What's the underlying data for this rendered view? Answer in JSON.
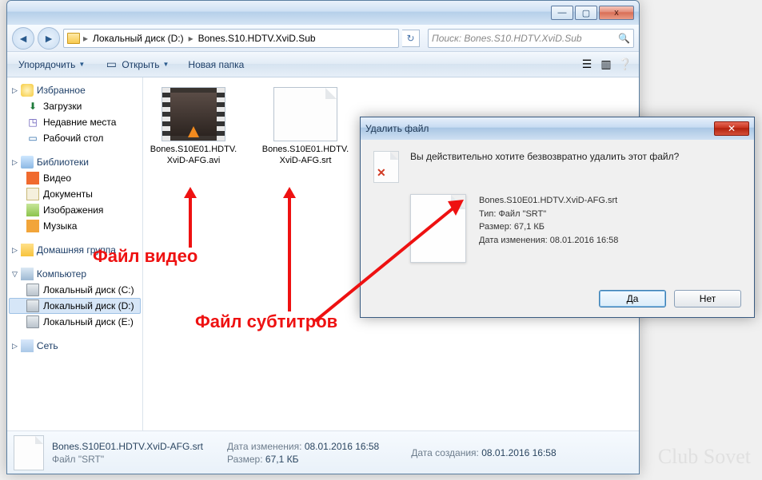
{
  "window": {
    "min": "—",
    "max": "▢",
    "close": "x"
  },
  "nav": {
    "back": "◄",
    "fwd": "►",
    "crumb_drive": "Локальный диск (D:)",
    "crumb_folder": "Bones.S10.HDTV.XviD.Sub",
    "sep": "▸",
    "search_placeholder": "Поиск: Bones.S10.HDTV.XviD.Sub"
  },
  "toolbar": {
    "organize": "Упорядочить",
    "open": "Открыть",
    "newfolder": "Новая папка"
  },
  "sidebar": {
    "fav": "Избранное",
    "fav_items": [
      "Загрузки",
      "Недавние места",
      "Рабочий стол"
    ],
    "lib": "Библиотеки",
    "lib_items": [
      "Видео",
      "Документы",
      "Изображения",
      "Музыка"
    ],
    "home": "Домашняя группа",
    "comp": "Компьютер",
    "drives": [
      "Локальный диск (C:)",
      "Локальный диск (D:)",
      "Локальный диск (E:)"
    ],
    "net": "Сеть"
  },
  "files": {
    "video": "Bones.S10E01.HDTV.XviD-AFG.avi",
    "srt": "Bones.S10E01.HDTV.XviD-AFG.srt"
  },
  "status": {
    "name": "Bones.S10E01.HDTV.XviD-AFG.srt",
    "type": "Файл \"SRT\"",
    "modified_lbl": "Дата изменения:",
    "modified_val": "08.01.2016 16:58",
    "size_lbl": "Размер:",
    "size_val": "67,1 КБ",
    "created_lbl": "Дата создания:",
    "created_val": "08.01.2016 16:58"
  },
  "dialog": {
    "title": "Удалить файл",
    "message": "Вы действительно хотите безвозвратно удалить этот файл?",
    "name": "Bones.S10E01.HDTV.XviD-AFG.srt",
    "type": "Тип: Файл \"SRT\"",
    "size": "Размер: 67,1 КБ",
    "modified": "Дата изменения: 08.01.2016 16:58",
    "yes": "Да",
    "no": "Нет"
  },
  "annot": {
    "video": "Файл видео",
    "sub": "Файл субтитров"
  },
  "watermark": "Club Sovet"
}
